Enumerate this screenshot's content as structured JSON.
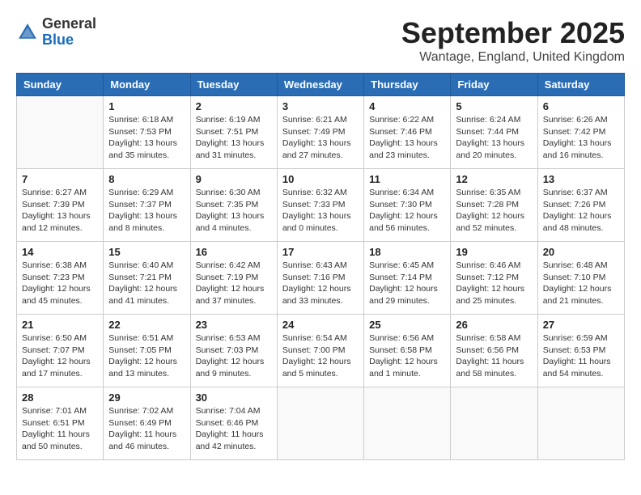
{
  "header": {
    "logo_general": "General",
    "logo_blue": "Blue",
    "month_title": "September 2025",
    "location": "Wantage, England, United Kingdom"
  },
  "weekdays": [
    "Sunday",
    "Monday",
    "Tuesday",
    "Wednesday",
    "Thursday",
    "Friday",
    "Saturday"
  ],
  "weeks": [
    [
      {
        "day": "",
        "info": ""
      },
      {
        "day": "1",
        "info": "Sunrise: 6:18 AM\nSunset: 7:53 PM\nDaylight: 13 hours\nand 35 minutes."
      },
      {
        "day": "2",
        "info": "Sunrise: 6:19 AM\nSunset: 7:51 PM\nDaylight: 13 hours\nand 31 minutes."
      },
      {
        "day": "3",
        "info": "Sunrise: 6:21 AM\nSunset: 7:49 PM\nDaylight: 13 hours\nand 27 minutes."
      },
      {
        "day": "4",
        "info": "Sunrise: 6:22 AM\nSunset: 7:46 PM\nDaylight: 13 hours\nand 23 minutes."
      },
      {
        "day": "5",
        "info": "Sunrise: 6:24 AM\nSunset: 7:44 PM\nDaylight: 13 hours\nand 20 minutes."
      },
      {
        "day": "6",
        "info": "Sunrise: 6:26 AM\nSunset: 7:42 PM\nDaylight: 13 hours\nand 16 minutes."
      }
    ],
    [
      {
        "day": "7",
        "info": "Sunrise: 6:27 AM\nSunset: 7:39 PM\nDaylight: 13 hours\nand 12 minutes."
      },
      {
        "day": "8",
        "info": "Sunrise: 6:29 AM\nSunset: 7:37 PM\nDaylight: 13 hours\nand 8 minutes."
      },
      {
        "day": "9",
        "info": "Sunrise: 6:30 AM\nSunset: 7:35 PM\nDaylight: 13 hours\nand 4 minutes."
      },
      {
        "day": "10",
        "info": "Sunrise: 6:32 AM\nSunset: 7:33 PM\nDaylight: 13 hours\nand 0 minutes."
      },
      {
        "day": "11",
        "info": "Sunrise: 6:34 AM\nSunset: 7:30 PM\nDaylight: 12 hours\nand 56 minutes."
      },
      {
        "day": "12",
        "info": "Sunrise: 6:35 AM\nSunset: 7:28 PM\nDaylight: 12 hours\nand 52 minutes."
      },
      {
        "day": "13",
        "info": "Sunrise: 6:37 AM\nSunset: 7:26 PM\nDaylight: 12 hours\nand 48 minutes."
      }
    ],
    [
      {
        "day": "14",
        "info": "Sunrise: 6:38 AM\nSunset: 7:23 PM\nDaylight: 12 hours\nand 45 minutes."
      },
      {
        "day": "15",
        "info": "Sunrise: 6:40 AM\nSunset: 7:21 PM\nDaylight: 12 hours\nand 41 minutes."
      },
      {
        "day": "16",
        "info": "Sunrise: 6:42 AM\nSunset: 7:19 PM\nDaylight: 12 hours\nand 37 minutes."
      },
      {
        "day": "17",
        "info": "Sunrise: 6:43 AM\nSunset: 7:16 PM\nDaylight: 12 hours\nand 33 minutes."
      },
      {
        "day": "18",
        "info": "Sunrise: 6:45 AM\nSunset: 7:14 PM\nDaylight: 12 hours\nand 29 minutes."
      },
      {
        "day": "19",
        "info": "Sunrise: 6:46 AM\nSunset: 7:12 PM\nDaylight: 12 hours\nand 25 minutes."
      },
      {
        "day": "20",
        "info": "Sunrise: 6:48 AM\nSunset: 7:10 PM\nDaylight: 12 hours\nand 21 minutes."
      }
    ],
    [
      {
        "day": "21",
        "info": "Sunrise: 6:50 AM\nSunset: 7:07 PM\nDaylight: 12 hours\nand 17 minutes."
      },
      {
        "day": "22",
        "info": "Sunrise: 6:51 AM\nSunset: 7:05 PM\nDaylight: 12 hours\nand 13 minutes."
      },
      {
        "day": "23",
        "info": "Sunrise: 6:53 AM\nSunset: 7:03 PM\nDaylight: 12 hours\nand 9 minutes."
      },
      {
        "day": "24",
        "info": "Sunrise: 6:54 AM\nSunset: 7:00 PM\nDaylight: 12 hours\nand 5 minutes."
      },
      {
        "day": "25",
        "info": "Sunrise: 6:56 AM\nSunset: 6:58 PM\nDaylight: 12 hours\nand 1 minute."
      },
      {
        "day": "26",
        "info": "Sunrise: 6:58 AM\nSunset: 6:56 PM\nDaylight: 11 hours\nand 58 minutes."
      },
      {
        "day": "27",
        "info": "Sunrise: 6:59 AM\nSunset: 6:53 PM\nDaylight: 11 hours\nand 54 minutes."
      }
    ],
    [
      {
        "day": "28",
        "info": "Sunrise: 7:01 AM\nSunset: 6:51 PM\nDaylight: 11 hours\nand 50 minutes."
      },
      {
        "day": "29",
        "info": "Sunrise: 7:02 AM\nSunset: 6:49 PM\nDaylight: 11 hours\nand 46 minutes."
      },
      {
        "day": "30",
        "info": "Sunrise: 7:04 AM\nSunset: 6:46 PM\nDaylight: 11 hours\nand 42 minutes."
      },
      {
        "day": "",
        "info": ""
      },
      {
        "day": "",
        "info": ""
      },
      {
        "day": "",
        "info": ""
      },
      {
        "day": "",
        "info": ""
      }
    ]
  ]
}
